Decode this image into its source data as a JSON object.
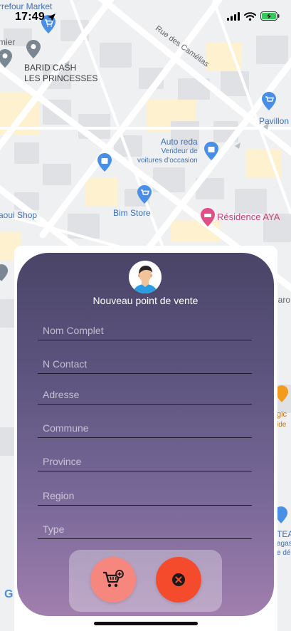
{
  "status_bar": {
    "time": "17:49",
    "icons": [
      "location-arrow-icon",
      "cellular-signal-icon",
      "wifi-icon",
      "battery-charging-icon"
    ]
  },
  "map": {
    "labels": {
      "carrefour": "rrefour Market",
      "street": "Rue des Camélias",
      "premier": "mier",
      "barid_line1": "BARID CASH",
      "barid_line2": "LES PRINCESSES",
      "pavillon": "Pavillon",
      "autoreda_title": "Auto reda",
      "autoreda_sub1": "Vendeur de",
      "autoreda_sub2": "voitures d'occasion",
      "aoui_shop": "aoui Shop",
      "bim_store": "Bim Store",
      "residence": "Résidence AYA",
      "right_iaro": "iaro",
      "right_gic": "gic",
      "right_ide": "ide",
      "right_tea": "TEA",
      "right_agasin": "agasin",
      "right_de": "e dé",
      "google": "G"
    },
    "colors": {
      "background": "#eef0f2",
      "block": "#dfe1e5",
      "road": "#ffffff",
      "yellow_area": "#fdf1cf",
      "poi_blue": "#4a8fe7",
      "poi_gray": "#7a8692",
      "poi_pink": "#e24f86",
      "poi_orange": "#f29b1f"
    }
  },
  "modal": {
    "title": "Nouveau point de vente",
    "avatar": "avatar-man-icon",
    "fields": [
      {
        "placeholder": "Nom Complet",
        "value": ""
      },
      {
        "placeholder": "N Contact",
        "value": ""
      },
      {
        "placeholder": "Adresse",
        "value": ""
      },
      {
        "placeholder": "Commune",
        "value": ""
      },
      {
        "placeholder": "Province",
        "value": ""
      },
      {
        "placeholder": "Region",
        "value": ""
      },
      {
        "placeholder": "Type",
        "value": ""
      }
    ],
    "actions": {
      "add": {
        "icon": "cart-plus-icon",
        "color": "#f6877e"
      },
      "close": {
        "icon": "close-circle-icon",
        "color": "#f54b2d"
      }
    },
    "gradient_top": "#4a4467",
    "gradient_bottom": "#a17fae"
  }
}
